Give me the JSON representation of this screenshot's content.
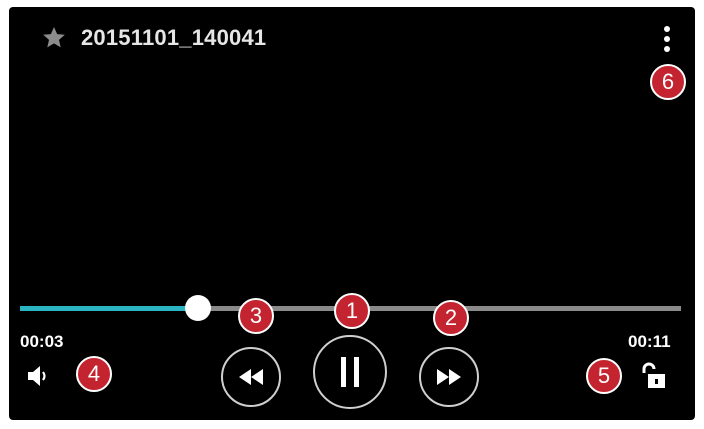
{
  "player": {
    "title": "20151101_140041",
    "current_time": "00:03",
    "total_time": "00:11",
    "progress": 0.27,
    "colors": {
      "background": "#000000",
      "progress_fill": "#2bb5c3",
      "progress_track": "#8a8a8a",
      "badge": "#c3242f"
    },
    "icons": {
      "favorite": "star-icon",
      "menu": "more-vertical-icon",
      "rewind": "rewind-icon",
      "pause": "pause-icon",
      "fast_forward": "fast-forward-icon",
      "volume": "volume-icon",
      "lock": "unlock-icon"
    }
  },
  "callouts": {
    "c1": "1",
    "c2": "2",
    "c3": "3",
    "c4": "4",
    "c5": "5",
    "c6": "6"
  }
}
